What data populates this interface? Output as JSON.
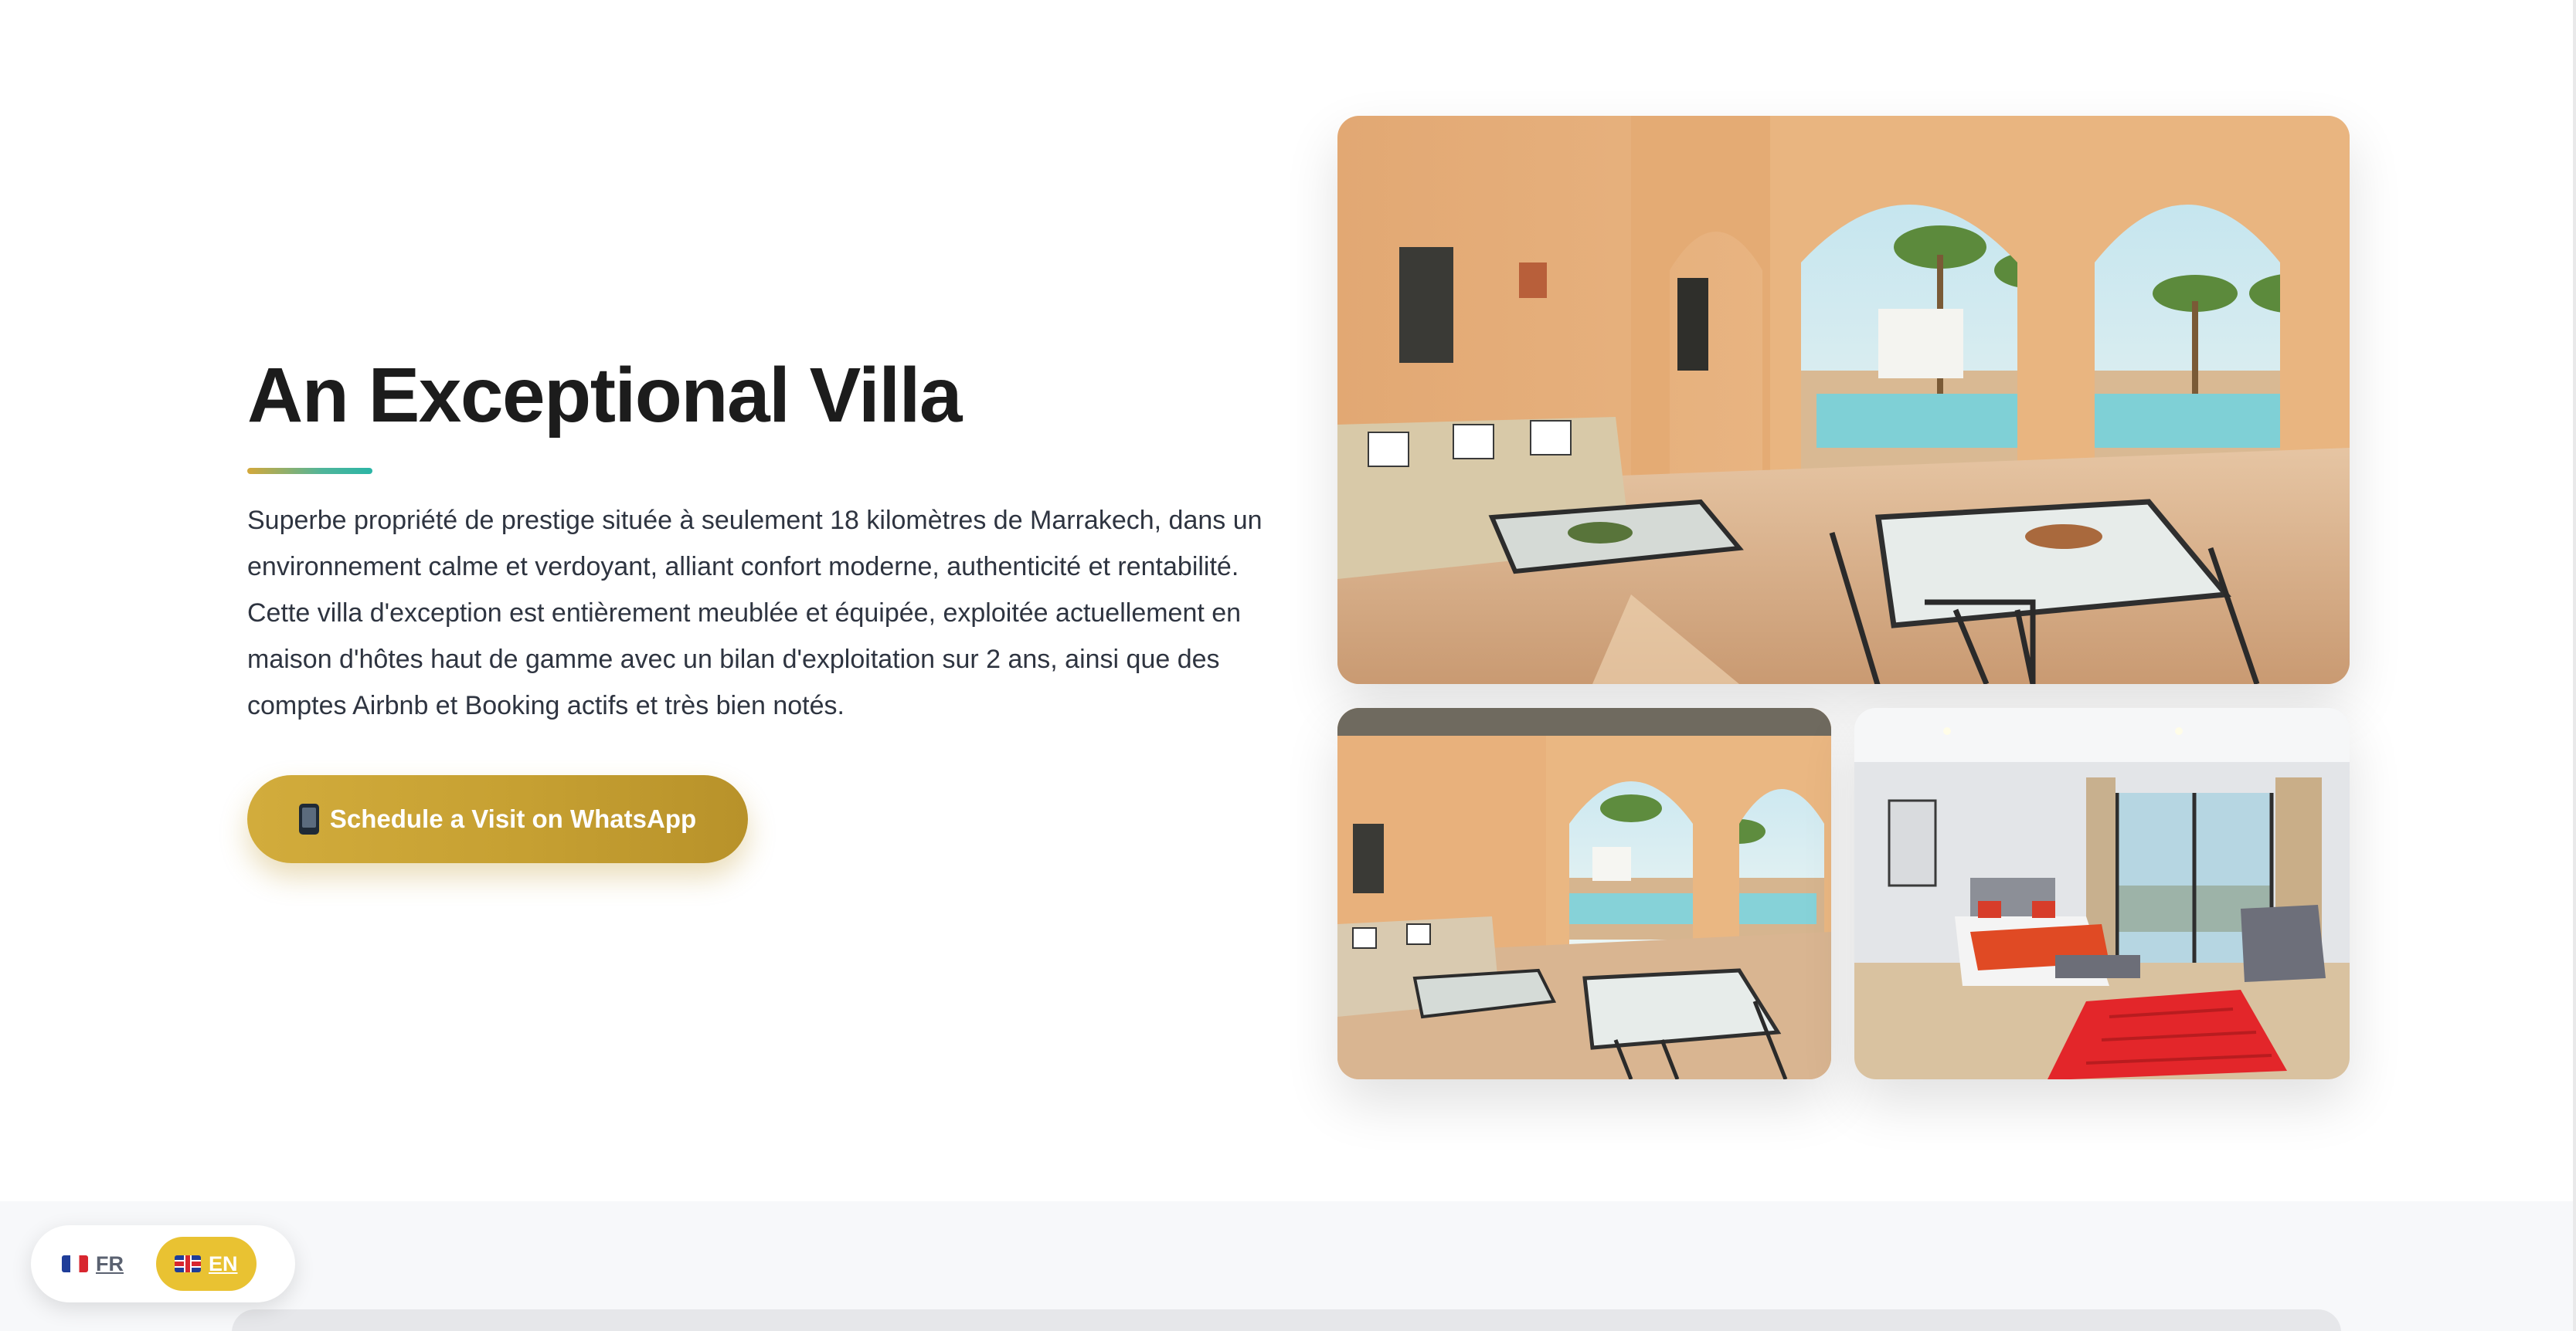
{
  "hero": {
    "title": "An Exceptional Villa",
    "description": "Superbe propriété de prestige située à seulement 18 kilomètres de Marrakech, dans un environnement calme et verdoyant, alliant confort moderne, authenticité et rentabilité. Cette villa d'exception est entièrement meublée et équipée, exploitée actuellement en maison d'hôtes haut de gamme avec un bilan d'exploitation sur 2 ans, ainsi que des comptes Airbnb et Booking actifs et très bien notés.",
    "cta_label": "Schedule a Visit on WhatsApp",
    "cta_icon": "mobile-phone-icon"
  },
  "gallery": {
    "photos": [
      {
        "subject": "covered-terrace-arches-pool",
        "alt": "Covered terrace with arches overlooking the pool"
      },
      {
        "subject": "covered-terrace-wide",
        "alt": "Covered terrace with lounge and dining area"
      },
      {
        "subject": "bedroom-red-rug",
        "alt": "Bedroom with red rug and terrace view"
      }
    ]
  },
  "language_switcher": {
    "options": [
      {
        "code": "FR",
        "flag": "flag-france-icon",
        "active": false
      },
      {
        "code": "EN",
        "flag": "flag-uk-icon",
        "active": true
      }
    ],
    "active_color": "#E9C232"
  },
  "colors": {
    "accent_gold": "#C6A032",
    "accent_teal": "#2BB5A6",
    "text_dark": "#1C1C1C",
    "text_body": "#2E3440"
  }
}
